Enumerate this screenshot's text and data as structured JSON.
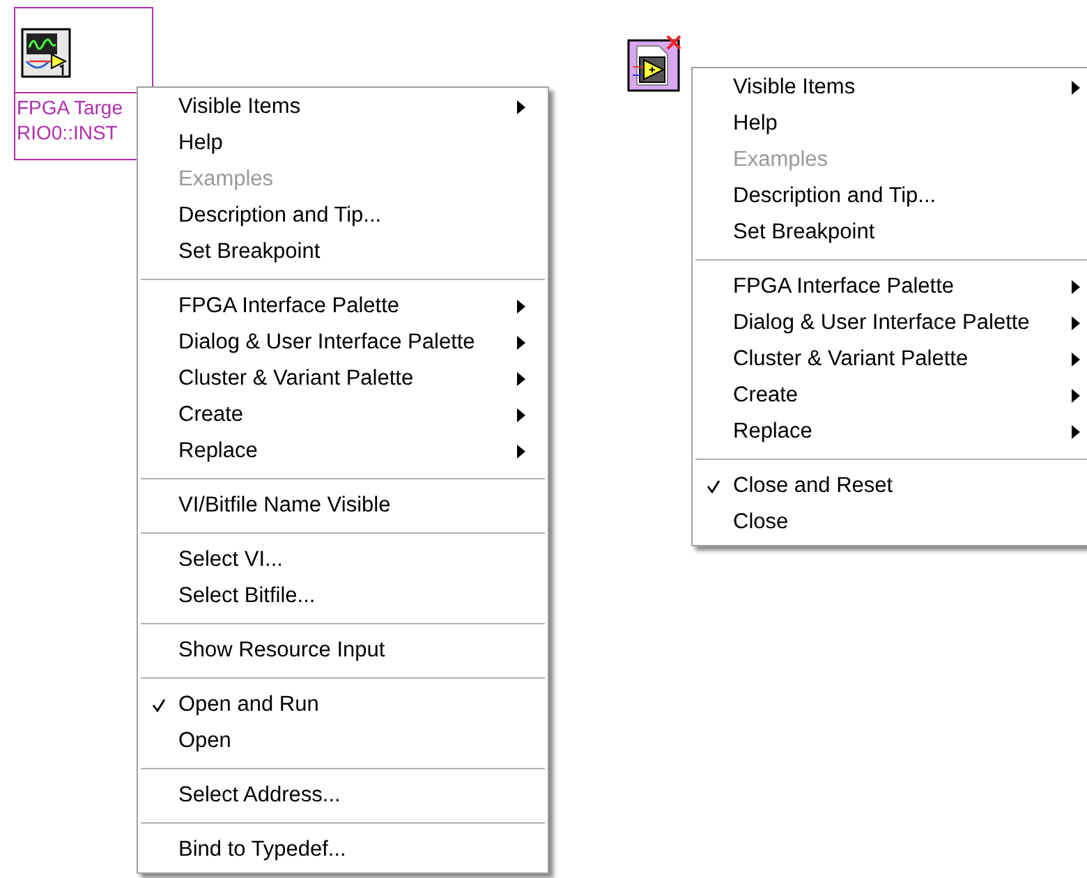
{
  "nodes": [
    {
      "kind": "fpga-target",
      "label_lines": [
        "FPGA Targe",
        "RIO0::INST"
      ]
    },
    {
      "kind": "close-reference"
    }
  ],
  "menus": [
    {
      "groups": [
        [
          {
            "label": "Visible Items",
            "submenu": true,
            "disabled": false,
            "checked": false
          },
          {
            "label": "Help",
            "submenu": false,
            "disabled": false,
            "checked": false
          },
          {
            "label": "Examples",
            "submenu": false,
            "disabled": true,
            "checked": false
          },
          {
            "label": "Description and Tip...",
            "submenu": false,
            "disabled": false,
            "checked": false
          },
          {
            "label": "Set Breakpoint",
            "submenu": false,
            "disabled": false,
            "checked": false
          }
        ],
        [
          {
            "label": "FPGA Interface Palette",
            "submenu": true,
            "disabled": false,
            "checked": false
          },
          {
            "label": "Dialog & User Interface Palette",
            "submenu": true,
            "disabled": false,
            "checked": false
          },
          {
            "label": "Cluster & Variant Palette",
            "submenu": true,
            "disabled": false,
            "checked": false
          },
          {
            "label": "Create",
            "submenu": true,
            "disabled": false,
            "checked": false
          },
          {
            "label": "Replace",
            "submenu": true,
            "disabled": false,
            "checked": false
          }
        ],
        [
          {
            "label": "VI/Bitfile Name Visible",
            "submenu": false,
            "disabled": false,
            "checked": false
          }
        ],
        [
          {
            "label": "Select VI...",
            "submenu": false,
            "disabled": false,
            "checked": false
          },
          {
            "label": "Select Bitfile...",
            "submenu": false,
            "disabled": false,
            "checked": false
          }
        ],
        [
          {
            "label": "Show Resource Input",
            "submenu": false,
            "disabled": false,
            "checked": false
          }
        ],
        [
          {
            "label": "Open and Run",
            "submenu": false,
            "disabled": false,
            "checked": true
          },
          {
            "label": "Open",
            "submenu": false,
            "disabled": false,
            "checked": false
          }
        ],
        [
          {
            "label": "Select Address...",
            "submenu": false,
            "disabled": false,
            "checked": false
          }
        ],
        [
          {
            "label": "Bind to Typedef...",
            "submenu": false,
            "disabled": false,
            "checked": false
          }
        ]
      ]
    },
    {
      "groups": [
        [
          {
            "label": "Visible Items",
            "submenu": true,
            "disabled": false,
            "checked": false
          },
          {
            "label": "Help",
            "submenu": false,
            "disabled": false,
            "checked": false
          },
          {
            "label": "Examples",
            "submenu": false,
            "disabled": true,
            "checked": false
          },
          {
            "label": "Description and Tip...",
            "submenu": false,
            "disabled": false,
            "checked": false
          },
          {
            "label": "Set Breakpoint",
            "submenu": false,
            "disabled": false,
            "checked": false
          }
        ],
        [
          {
            "label": "FPGA Interface Palette",
            "submenu": true,
            "disabled": false,
            "checked": false
          },
          {
            "label": "Dialog & User Interface Palette",
            "submenu": true,
            "disabled": false,
            "checked": false
          },
          {
            "label": "Cluster & Variant Palette",
            "submenu": true,
            "disabled": false,
            "checked": false
          },
          {
            "label": "Create",
            "submenu": true,
            "disabled": false,
            "checked": false
          },
          {
            "label": "Replace",
            "submenu": true,
            "disabled": false,
            "checked": false
          }
        ],
        [
          {
            "label": "Close and Reset",
            "submenu": false,
            "disabled": false,
            "checked": true
          },
          {
            "label": "Close",
            "submenu": false,
            "disabled": false,
            "checked": false
          }
        ]
      ]
    }
  ]
}
